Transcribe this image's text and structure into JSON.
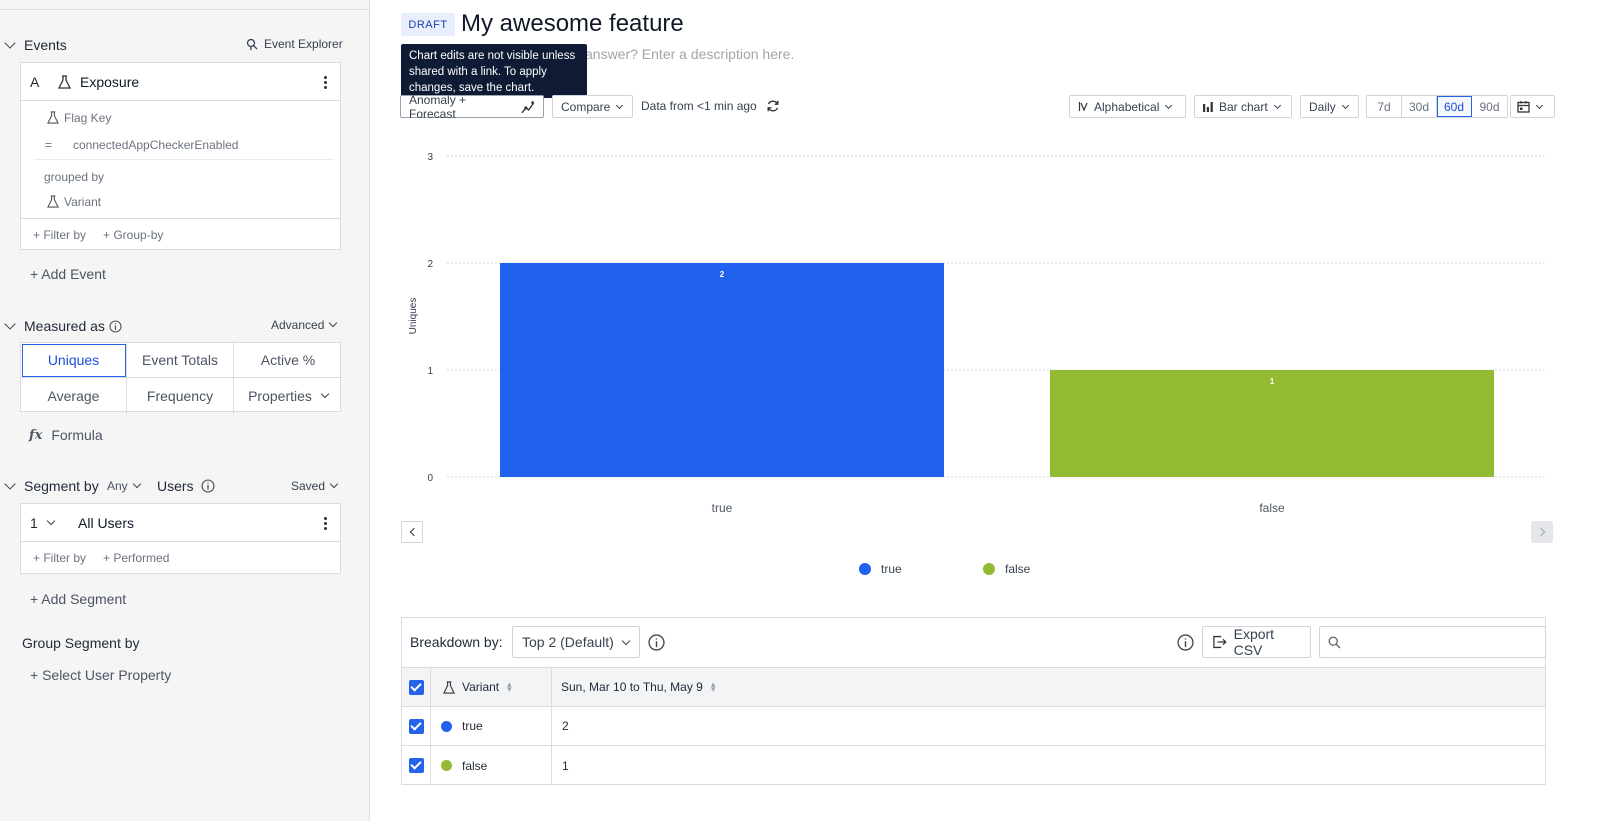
{
  "sidebar": {
    "events_title": "Events",
    "event_explorer": "Event Explorer",
    "event": {
      "letter": "A",
      "name": "Exposure",
      "property": "Flag Key",
      "operator": "=",
      "value": "connectedAppCheckerEnabled",
      "grouped_by_label": "grouped by",
      "group_property": "Variant",
      "filter_by": "+ Filter by",
      "group_by": "+ Group-by"
    },
    "add_event": "+ Add Event",
    "measured_as": "Measured as",
    "advanced": "Advanced",
    "measures": [
      "Uniques",
      "Event Totals",
      "Active %",
      "Average",
      "Frequency",
      "Properties"
    ],
    "formula_icon_text": "fx",
    "formula": "Formula",
    "segment_by": "Segment by",
    "segment_any": "Any",
    "segment_users": "Users",
    "saved": "Saved",
    "segment": {
      "index": "1",
      "name": "All Users",
      "filter_by": "+ Filter by",
      "performed": "+ Performed"
    },
    "add_segment": "+ Add Segment",
    "group_segment_by": "Group Segment by",
    "select_user_property": "+ Select User Property"
  },
  "header": {
    "badge": "DRAFT",
    "title": "My awesome feature",
    "description_placeholder": "answer? Enter a description here.",
    "tooltip": "Chart edits are not visible unless shared with a link. To apply changes, save the chart."
  },
  "toolbar": {
    "anomaly": "Anomaly + Forecast",
    "compare": "Compare",
    "data_from": "Data from <1 min ago",
    "sort": "Alphabetical",
    "chart_type": "Bar chart",
    "interval": "Daily",
    "ranges": [
      "7d",
      "30d",
      "60d",
      "90d"
    ],
    "active_range": "60d"
  },
  "chart_data": {
    "type": "bar",
    "categories": [
      "true",
      "false"
    ],
    "values": [
      2,
      1
    ],
    "ylabel": "Uniques",
    "ylim": [
      0,
      3
    ],
    "yticks": [
      "0",
      "1",
      "2",
      "3"
    ],
    "colors": [
      "#2161ee",
      "#92ba32"
    ],
    "legend": [
      "true",
      "false"
    ],
    "data_labels": [
      "2",
      "1"
    ],
    "grid": true,
    "legend_position": "bottom"
  },
  "breakdown": {
    "label": "Breakdown by:",
    "selection": "Top 2 (Default)",
    "export": "Export CSV",
    "columns": [
      "Variant",
      "Sun, Mar 10 to Thu, May 9"
    ],
    "rows": [
      {
        "name": "true",
        "value": "2",
        "color": "#2161ee"
      },
      {
        "name": "false",
        "value": "1",
        "color": "#92ba32"
      }
    ]
  }
}
